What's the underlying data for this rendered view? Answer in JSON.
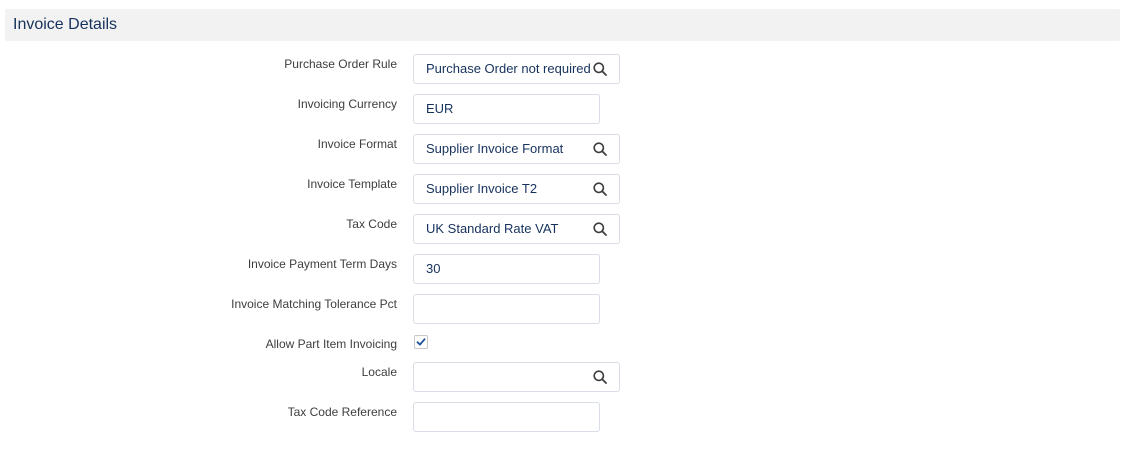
{
  "section": {
    "title": "Invoice Details"
  },
  "fields": {
    "purchase_order_rule": {
      "label": "Purchase Order Rule",
      "value": "Purchase Order not required",
      "icon": "search-icon"
    },
    "invoicing_currency": {
      "label": "Invoicing Currency",
      "value": "EUR"
    },
    "invoice_format": {
      "label": "Invoice Format",
      "value": "Supplier Invoice Format",
      "icon": "search-icon"
    },
    "invoice_template": {
      "label": "Invoice Template",
      "value": "Supplier Invoice T2",
      "icon": "search-icon"
    },
    "tax_code": {
      "label": "Tax Code",
      "value": "UK Standard Rate VAT",
      "icon": "search-icon"
    },
    "invoice_payment_term_days": {
      "label": "Invoice Payment Term Days",
      "value": "30"
    },
    "invoice_matching_tolerance_pct": {
      "label": "Invoice Matching Tolerance Pct",
      "value": ""
    },
    "allow_part_item_invoicing": {
      "label": "Allow Part Item Invoicing",
      "checked": true,
      "icon": "checkmark-icon"
    },
    "locale": {
      "label": "Locale",
      "value": "",
      "icon": "search-icon"
    },
    "tax_code_reference": {
      "label": "Tax Code Reference",
      "value": ""
    }
  },
  "colors": {
    "header_bg": "#f3f2f2",
    "title": "#16325c",
    "border": "#d8dde6",
    "check": "#1b5297"
  }
}
